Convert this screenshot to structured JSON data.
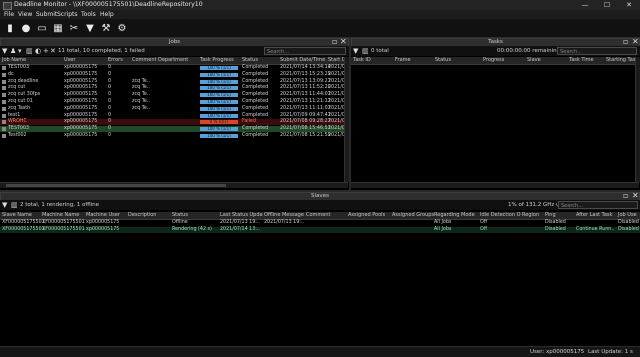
{
  "app": {
    "title": "Deadline Monitor  -  \\\\XF000005175501\\DeadlineRepository10",
    "min": "—",
    "max": "☐",
    "close": "✕"
  },
  "menu": [
    "File",
    "View",
    "Submit",
    "Scripts",
    "Tools",
    "Help"
  ],
  "colors": {
    "accent_progress": "#5aa0d6",
    "failed": "#d9462b",
    "selected_row": "#1f4a2a",
    "window_bg": "#000000"
  },
  "toolbar_icons": [
    "monitor-icon",
    "person-icon",
    "window-icon",
    "calendar-icon",
    "cut-icon",
    "bookmark-icon",
    "hammer-icon",
    "gear-icon"
  ],
  "jobs": {
    "panel_title": "Jobs",
    "summary": "11 total, 10 completed, 1 failed",
    "search_placeholder": "Search...",
    "columns": [
      "Job Name",
      "User",
      "Errors",
      "Comment",
      "Department",
      "Task Progress",
      "Status",
      "Submit Date/Time",
      "Start D"
    ],
    "rows": [
      {
        "name": "TEST003",
        "user": "xp000005175",
        "errors": "0",
        "comment": "",
        "dept": "",
        "progress": "100 %",
        "tasks": "(1/1)",
        "status": "Completed",
        "submit": "2021/07/14 13:34:14",
        "start": "2021/0"
      },
      {
        "name": "dc",
        "user": "xp000005175",
        "errors": "0",
        "comment": "",
        "dept": "",
        "progress": "100 %",
        "tasks": "(1/1)",
        "status": "Completed",
        "submit": "2021/07/13 15:23:29",
        "start": "2021/0"
      },
      {
        "name": "zcq deadline",
        "user": "xp000005175",
        "errors": "0",
        "comment": "zcq Te..",
        "dept": "",
        "progress": "100 %",
        "tasks": "(1/1)",
        "status": "Completed",
        "submit": "2021/07/13 13:09:27",
        "start": "2021/0"
      },
      {
        "name": "zcq cut",
        "user": "xp000005175",
        "errors": "0",
        "comment": "zcq Te..",
        "dept": "",
        "progress": "100 %",
        "tasks": "(1/1)",
        "status": "Completed",
        "submit": "2021/07/13 11:52:20",
        "start": "2021/0"
      },
      {
        "name": "zcq cut 30fps",
        "user": "xp000005175",
        "errors": "0",
        "comment": "zcq Te..",
        "dept": "",
        "progress": "100 %",
        "tasks": "(1/1)",
        "status": "Completed",
        "submit": "2021/07/13 11:44:01",
        "start": "2021/0"
      },
      {
        "name": "zcq cut 01",
        "user": "xp000005175",
        "errors": "0",
        "comment": "zcq Te..",
        "dept": "",
        "progress": "100 %",
        "tasks": "(1/1)",
        "status": "Completed",
        "submit": "2021/07/13 11:21:11",
        "start": "2021/0"
      },
      {
        "name": "zcq Tasth",
        "user": "xp000005175",
        "errors": "0",
        "comment": "zcq Te..",
        "dept": "",
        "progress": "100 %",
        "tasks": "(1/1)",
        "status": "Completed",
        "submit": "2021/07/13 11:11:07",
        "start": "2021/0"
      },
      {
        "name": "test1",
        "user": "xp000005175",
        "errors": "0",
        "comment": "",
        "dept": "",
        "progress": "100 %",
        "tasks": "(1/1)",
        "status": "Completed",
        "submit": "2021/07/09 09:47:41",
        "start": "2021/0"
      },
      {
        "name": "WROHC",
        "user": "xp000005175",
        "errors": "0",
        "comment": "",
        "dept": "",
        "progress": "0 %",
        "tasks": "(0/1)",
        "status": "Failed",
        "submit": "2021/07/08 09:28:27",
        "start": "2021/0"
      },
      {
        "name": "TEST003",
        "user": "xp000005175",
        "errors": "0",
        "comment": "",
        "dept": "",
        "progress": "100 %",
        "tasks": "(1/1)",
        "status": "Completed",
        "submit": "2021/07/08 15:46:51",
        "start": "2021/0"
      },
      {
        "name": "Test002",
        "user": "xp000005175",
        "errors": "0",
        "comment": "",
        "dept": "",
        "progress": "100 %",
        "tasks": "(1/1)",
        "status": "Completed",
        "submit": "2021/07/08 15:21:59",
        "start": "2021/0"
      }
    ]
  },
  "tasks": {
    "panel_title": "Tasks",
    "summary": "0 total",
    "remaining": "00:00:00:00 remaining",
    "search_placeholder": "Search...",
    "columns": [
      "Task ID",
      "Frame",
      "Status",
      "Progress",
      "Slave",
      "Task Time",
      "Starting Tas"
    ]
  },
  "slaves": {
    "panel_title": "Slaves",
    "summary": "2 total, 1 rendering, 1 offline",
    "utilization": "1% of 131.2 GHz utilization",
    "search_placeholder": "Search...",
    "columns": [
      "Slave Name",
      "Machine Name",
      "Machine User",
      "Description",
      "Status",
      "Last Status Upda",
      "Offline Message",
      "Comment",
      "Assigned Pools",
      "Assigned Groups",
      "Regarding Mode",
      "Idle Detection O",
      "Region",
      "Ping",
      "After Last Task",
      "Job Use"
    ],
    "rows": [
      {
        "name": "XF000005175501",
        "machine": "XF000005175501",
        "muser": "xp000005175",
        "desc": "",
        "status": "Offline",
        "last": "2021/07/13 19:..",
        "offline": "2021/07/13 19:..",
        "comment": "",
        "pools": "",
        "groups": "",
        "mode": "All Jobs",
        "idle": "Off",
        "region": "",
        "ping": "Disabled",
        "after": "",
        "jobuse": "Disabled"
      },
      {
        "name": "XF000005175501",
        "machine": "XF000005175501",
        "muser": "xp000005175",
        "desc": "",
        "status": "Rendering (42 s)",
        "last": "2021/07/14 13:..",
        "offline": "",
        "comment": "",
        "pools": "",
        "groups": "",
        "mode": "All Jobs",
        "idle": "Off",
        "region": "",
        "ping": "Disabled",
        "after": "Continue Runn..",
        "jobuse": "Disabled"
      }
    ]
  },
  "status": {
    "user": "User:  xp000005175",
    "last_update": "Last Update: 1 s"
  }
}
